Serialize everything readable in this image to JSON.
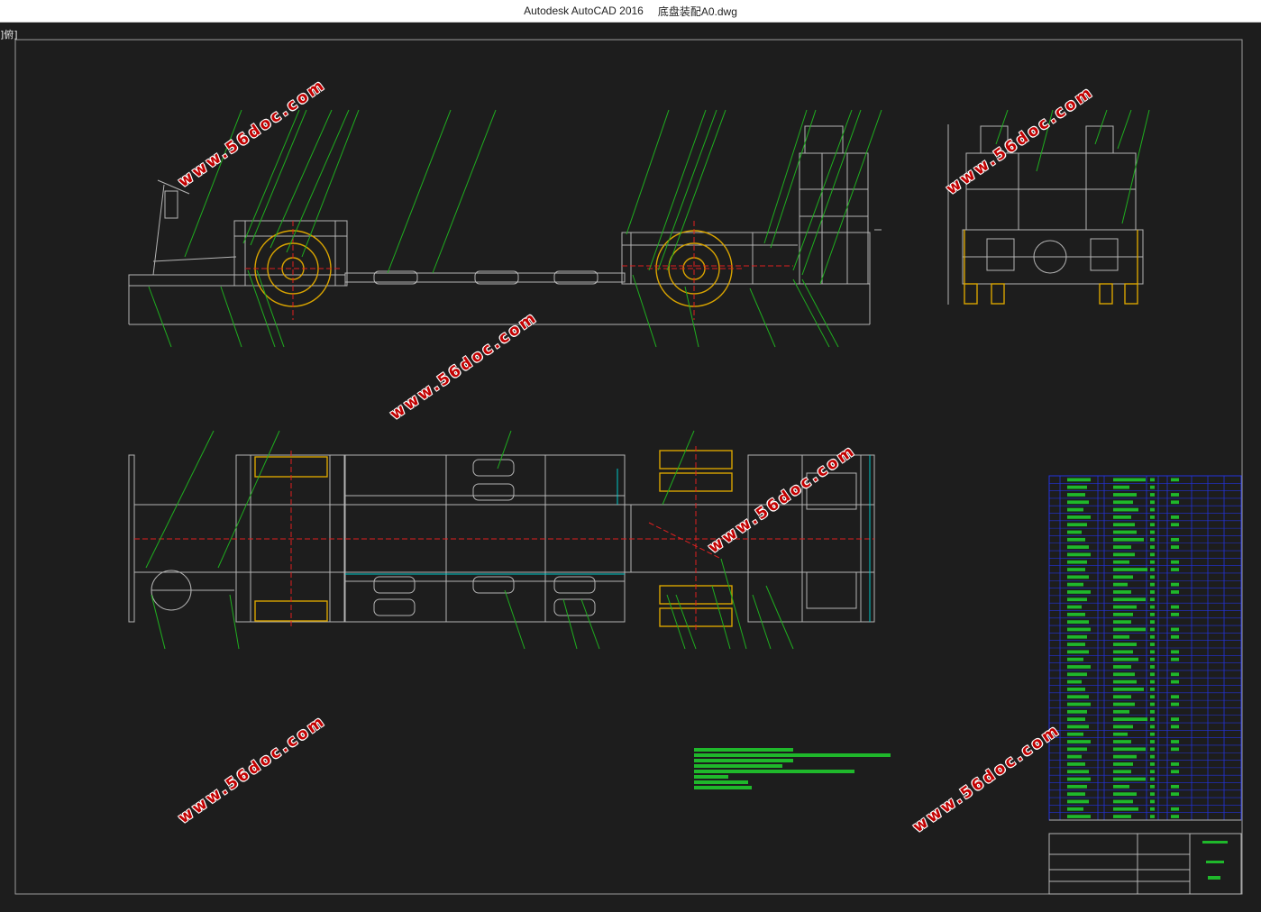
{
  "window": {
    "app_name": "Autodesk AutoCAD 2016",
    "file_name": "底盘装配A0.dwg"
  },
  "viewport": {
    "view_label": "]俯]"
  },
  "watermark": {
    "text": "www.56doc.com",
    "color": "#c20000"
  },
  "colors": {
    "background": "#1d1d1d",
    "frame_lines": "#b4b4b4",
    "leader_lines": "#1fae1f",
    "center_lines": "#e02020",
    "wheels": "#d9a400",
    "dimension_cyan": "#00c8c8",
    "bom_blue": "#2233dd",
    "bom_green": "#1fb82b"
  }
}
